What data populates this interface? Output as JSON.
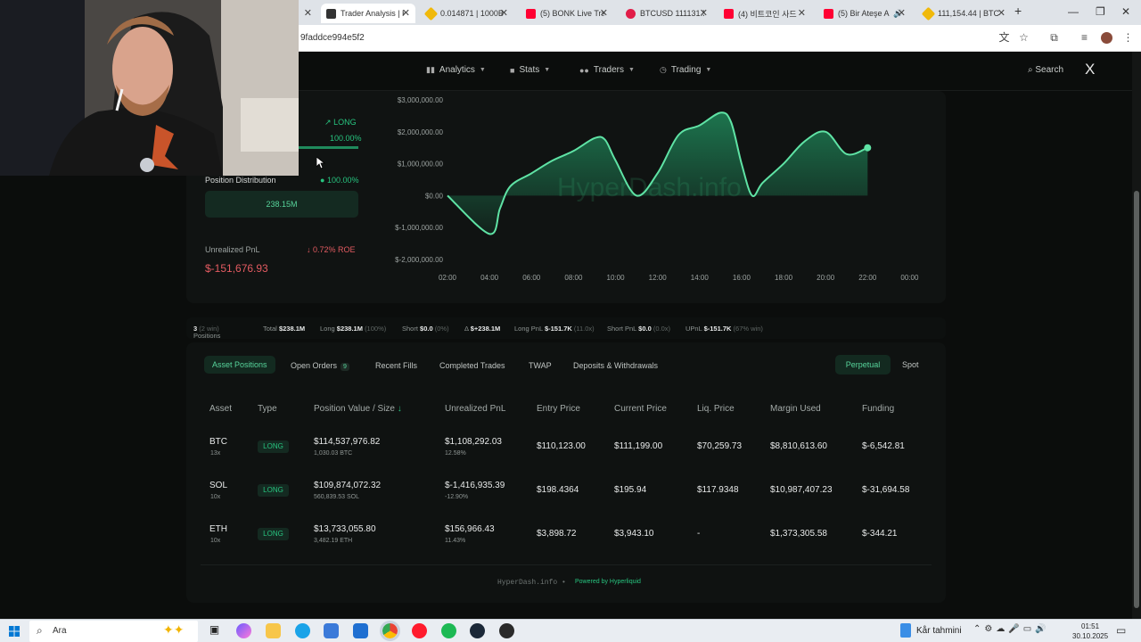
{
  "browser": {
    "tabs": [
      {
        "title": "Trader Analysis | H",
        "active": true,
        "color": "#333333"
      },
      {
        "title": "0.014871 | 1000B",
        "color": "#f0b90b"
      },
      {
        "title": "(5) BONK Live Tra",
        "color": "#ff0033"
      },
      {
        "title": "BTCUSD 111131.5",
        "color": "#e11d48"
      },
      {
        "title": "(4) 비트코인 사드",
        "color": "#ff0033"
      },
      {
        "title": "(5) Bir Ateşe A",
        "color": "#ff0033"
      },
      {
        "title": "111,154.44 | BTC",
        "color": "#f0b90b"
      }
    ],
    "url": "9faddce994e5f2"
  },
  "nav": {
    "analytics": "Analytics",
    "stats": "Stats",
    "traders": "Traders",
    "trading": "Trading",
    "search": "Search",
    "x_label": "X"
  },
  "overview": {
    "long_label": "LONG",
    "long_pct": "100.00%",
    "position_distribution_label": "Position Distribution",
    "position_distribution_pct": "100.00%",
    "position_value": "238.15M",
    "unrealized_pnl_label": "Unrealized PnL",
    "roe": "0.72% ROE",
    "unrealized_pnl_value": "$-151,676.93"
  },
  "chart_data": {
    "type": "area",
    "title": "",
    "watermark": "HyperDash.info",
    "y_ticks": [
      "$3,000,000.00",
      "$2,000,000.00",
      "$1,000,000.00",
      "$0.00",
      "$-1,000,000.00",
      "$-2,000,000.00"
    ],
    "x_ticks": [
      "02:00",
      "04:00",
      "06:00",
      "08:00",
      "10:00",
      "12:00",
      "14:00",
      "16:00",
      "18:00",
      "20:00",
      "22:00",
      "00:00"
    ],
    "ylim": [
      -2000000,
      3000000
    ],
    "x": [
      0,
      2,
      2.5,
      3,
      4,
      5,
      6,
      7,
      7.5,
      8,
      9,
      10,
      11,
      12,
      13,
      13.5,
      14,
      14.5,
      15,
      16,
      17,
      18,
      19,
      20,
      21,
      21.5,
      22,
      23,
      24
    ],
    "values": [
      0,
      -1200000,
      -400000,
      300000,
      700000,
      1100000,
      1400000,
      1800000,
      1750000,
      1100000,
      0,
      700000,
      1900000,
      2200000,
      2600000,
      2300000,
      1000000,
      0,
      400000,
      1000000,
      1700000,
      2000000,
      1300000,
      1500000
    ]
  },
  "summary": {
    "positions_label": "Positions",
    "positions_value": "3",
    "positions_win": "(2 win)",
    "total_label": "Total",
    "total_value": "$238.1M",
    "long_label": "Long",
    "long_value": "$238.1M",
    "long_pct": "(100%)",
    "short_label": "Short",
    "short_value": "$0.0",
    "short_pct": "(0%)",
    "delta_label": "Δ",
    "delta_value": "$+238.1M",
    "longpnl_label": "Long PnL",
    "longpnl_value": "$-151.7K",
    "longpnl_x": "(11.0x)",
    "shortpnl_label": "Short PnL",
    "shortpnl_value": "$0.0",
    "shortpnl_x": "(0.0x)",
    "upnl_label": "UPnL",
    "upnl_value": "$-151.7K",
    "upnl_win": "(67% win)"
  },
  "tabs": {
    "asset_positions": "Asset Positions",
    "open_orders": "Open Orders",
    "open_orders_count": "9",
    "recent_fills": "Recent Fills",
    "completed_trades": "Completed Trades",
    "twap": "TWAP",
    "deposits": "Deposits & Withdrawals",
    "perpetual": "Perpetual",
    "spot": "Spot"
  },
  "table": {
    "headers": [
      "Asset",
      "Type",
      "Position Value / Size",
      "Unrealized PnL",
      "Entry Price",
      "Current Price",
      "Liq. Price",
      "Margin Used",
      "Funding"
    ],
    "rows": [
      {
        "asset": "BTC",
        "lev": "13x",
        "type": "LONG",
        "value": "$114,537,976.82",
        "size": "1,030.03 BTC",
        "pnl": "$1,108,292.03",
        "pnl_pct": "12.58%",
        "pnl_sign": "pos",
        "entry": "$110,123.00",
        "current": "$111,199.00",
        "liq": "$70,259.73",
        "margin": "$8,810,613.60",
        "funding": "$-6,542.81"
      },
      {
        "asset": "SOL",
        "lev": "10x",
        "type": "LONG",
        "value": "$109,874,072.32",
        "size": "560,839.53 SOL",
        "pnl": "$-1,416,935.39",
        "pnl_pct": "-12.90%",
        "pnl_sign": "neg",
        "entry": "$198.4364",
        "current": "$195.94",
        "liq": "$117.9348",
        "margin": "$10,987,407.23",
        "funding": "$-31,694.58"
      },
      {
        "asset": "ETH",
        "lev": "10x",
        "type": "LONG",
        "value": "$13,733,055.80",
        "size": "3,482.19 ETH",
        "pnl": "$156,966.43",
        "pnl_pct": "11.43%",
        "pnl_sign": "pos",
        "entry": "$3,898.72",
        "current": "$3,943.10",
        "liq": "-",
        "margin": "$1,373,305.58",
        "funding": "$-344.21"
      }
    ]
  },
  "footer": {
    "site": "HyperDash.info",
    "powered": "Powered by Hyperliquid"
  },
  "taskbar": {
    "search_placeholder": "Ara",
    "weather": "Kår tahmini",
    "time": "01:51",
    "date": "30.10.2025"
  },
  "colors": {
    "accent_green": "#27c47f",
    "negative_red": "#e35b61",
    "background": "#0b0d0c"
  }
}
